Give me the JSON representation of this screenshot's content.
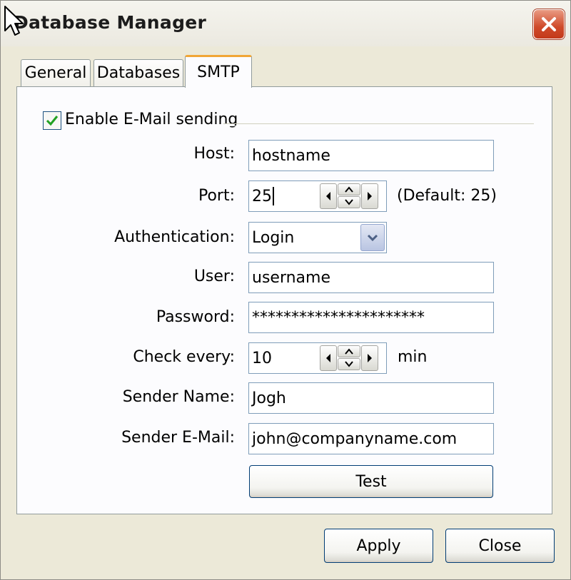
{
  "window": {
    "title": "Database Manager"
  },
  "tabs": [
    {
      "label": "General",
      "selected": false
    },
    {
      "label": "Databases",
      "selected": false
    },
    {
      "label": "SMTP",
      "selected": true
    }
  ],
  "smtp": {
    "enable_label": "Enable E-Mail sending",
    "enable_checked": true,
    "host": {
      "label": "Host:",
      "value": "hostname"
    },
    "port": {
      "label": "Port:",
      "value": "25",
      "hint": "(Default: 25)"
    },
    "authentication": {
      "label": "Authentication:",
      "value": "Login"
    },
    "user": {
      "label": "User:",
      "value": "username"
    },
    "password": {
      "label": "Password:",
      "value": "**********************"
    },
    "check_every": {
      "label": "Check every:",
      "value": "10",
      "unit": "min"
    },
    "sender_name": {
      "label": "Sender Name:",
      "value": "Jogh"
    },
    "sender_email": {
      "label": "Sender E-Mail:",
      "value": "john@companyname.com"
    },
    "test_label": "Test"
  },
  "footer": {
    "apply_label": "Apply",
    "close_label": "Close"
  },
  "icons": {
    "close": "close-x-icon",
    "check": "checkmark-icon",
    "spin": [
      "arrow-left-icon",
      "arrow-up-icon",
      "arrow-down-icon",
      "arrow-right-icon"
    ],
    "dropdown": "chevron-down-icon",
    "cursor": "mouse-pointer-icon"
  },
  "colors": {
    "dialog_bg": "#ece9d8",
    "active_tab_accent": "#f1a636",
    "close_button": "#cf4a2a",
    "field_border": "#7f9db9",
    "button_border": "#003c74",
    "checkmark": "#21a121"
  }
}
